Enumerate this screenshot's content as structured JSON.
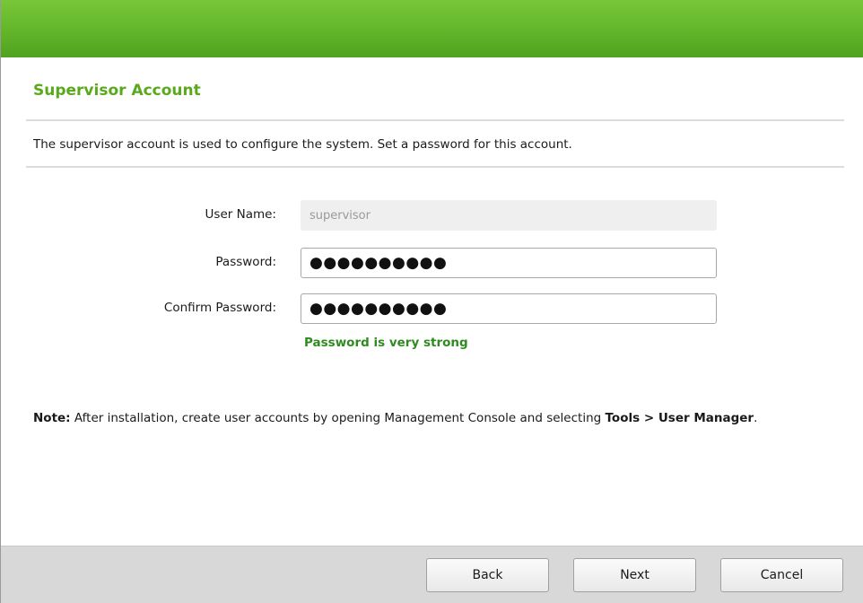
{
  "header": {
    "title": "Supervisor Account"
  },
  "description": "The supervisor account is used to configure the system. Set a password for this account.",
  "form": {
    "user_name_label": "User Name:",
    "user_name_value": "supervisor",
    "password_label": "Password:",
    "password_value": "●●●●●●●●●●",
    "confirm_label": "Confirm Password:",
    "confirm_value": "●●●●●●●●●●",
    "strength_message": "Password is very strong"
  },
  "note": {
    "prefix": "Note:",
    "text": " After installation, create user accounts by opening Management Console and selecting ",
    "menu_path": "Tools > User Manager",
    "suffix": "."
  },
  "buttons": {
    "back": "Back",
    "next": "Next",
    "cancel": "Cancel"
  },
  "colors": {
    "banner": "#62b52a",
    "title": "#5aa91c",
    "strength": "#2e8b1f"
  }
}
